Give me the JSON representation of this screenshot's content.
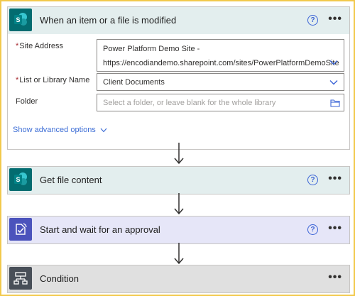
{
  "trigger": {
    "title": "When an item or a file is modified",
    "help": "?",
    "more": "•••",
    "site_label": "Site Address",
    "site_value_line1": "Power Platform Demo Site -",
    "site_value_line2": "https://encodiandemo.sharepoint.com/sites/PowerPlatformDemoSite",
    "list_label": "List or Library Name",
    "list_value": "Client Documents",
    "folder_label": "Folder",
    "folder_placeholder": "Select a folder, or leave blank for the whole library",
    "advanced": "Show advanced options",
    "required_mark": "*"
  },
  "steps": [
    {
      "title": "Get file content",
      "help": "?",
      "more": "•••",
      "icon": "sharepoint-icon"
    },
    {
      "title": "Start and wait for an approval",
      "help": "?",
      "more": "•••",
      "icon": "approval-icon"
    },
    {
      "title": "Condition",
      "more": "•••",
      "icon": "condition-icon"
    }
  ],
  "colors": {
    "sharepoint": "#036c70",
    "approval": "#4b53bc",
    "condition": "#484f58",
    "link": "#3f6fd6",
    "frame": "#f2c94c"
  }
}
